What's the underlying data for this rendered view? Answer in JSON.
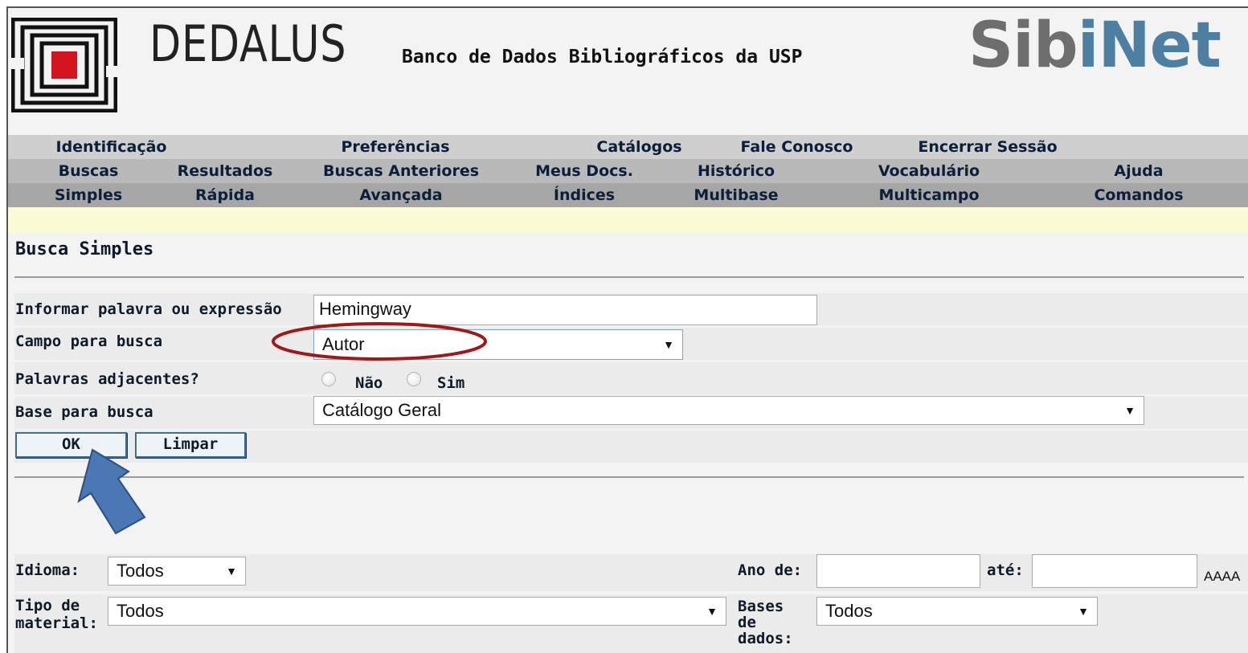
{
  "header": {
    "brand": "DEDALUS",
    "subtitle": "Banco de Dados Bibliográficos da USP",
    "network_part1": "Sib",
    "network_part2": "iNet"
  },
  "nav": {
    "row1": [
      "Identificação",
      "Preferências",
      "Catálogos",
      "Fale Conosco",
      "Encerrar Sessão",
      ""
    ],
    "row2": [
      "Buscas",
      "Resultados",
      "Buscas Anteriores",
      "Meus Docs.",
      "Histórico",
      "Vocabulário",
      "Ajuda"
    ],
    "row3": [
      "Simples",
      "Rápida",
      "Avançada",
      "Índices",
      "Multibase",
      "Multicampo",
      "Comandos"
    ]
  },
  "page_title": "Busca Simples",
  "form": {
    "term_label": "Informar palavra ou expressão",
    "term_value": "Hemingway",
    "field_label": "Campo para busca",
    "field_value": "Autor",
    "adjacent_label": "Palavras adjacentes?",
    "adjacent_no": "Não",
    "adjacent_yes": "Sim",
    "base_label": "Base para busca",
    "base_value": "Catálogo Geral",
    "ok_label": "OK",
    "clear_label": "Limpar"
  },
  "filters": {
    "language_label": "Idioma:",
    "language_value": "Todos",
    "year_from_label": "Ano de:",
    "year_to_label": "até:",
    "year_format": "AAAA",
    "material_label_1": "Tipo de",
    "material_label_2": "material:",
    "material_value": "Todos",
    "databases_label_1": "Bases",
    "databases_label_2": "de",
    "databases_label_3": "dados:",
    "databases_value": "Todos"
  },
  "colors": {
    "annotation_ellipse": "#a01818",
    "annotation_arrow": "#4a78b5",
    "brand_blue": "#4d7fa3"
  }
}
